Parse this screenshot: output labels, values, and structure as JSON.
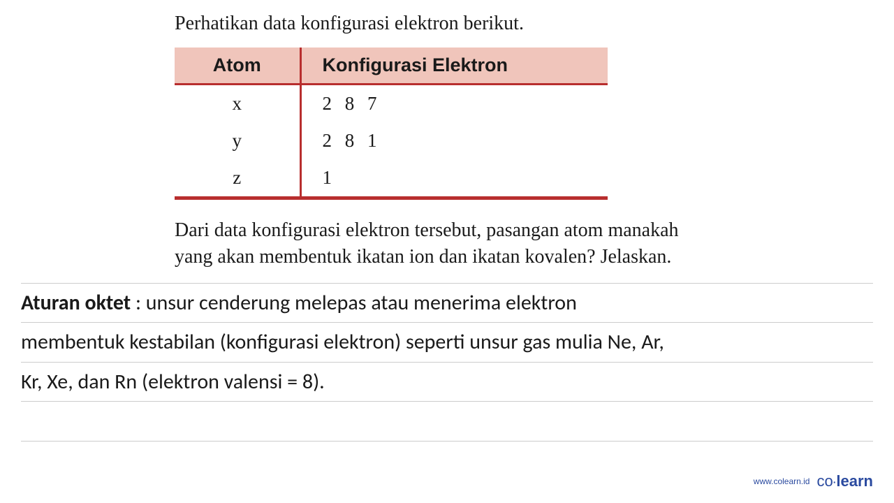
{
  "intro": "Perhatikan data konfigurasi elektron berikut.",
  "table": {
    "headers": {
      "col1": "Atom",
      "col2": "Konfigurasi Elektron"
    },
    "rows": [
      {
        "atom": "x",
        "config": "2 8 7"
      },
      {
        "atom": "y",
        "config": "2 8 1"
      },
      {
        "atom": "z",
        "config": "1"
      }
    ]
  },
  "question": "Dari data konfigurasi elektron tersebut, pasangan atom manakah yang akan membentuk ikatan ion dan ikatan kovalen? Jelaskan.",
  "explanation": {
    "term": "Aturan oktet",
    "line1_rest": " : unsur cenderung melepas atau menerima elektron",
    "line2": "membentuk kestabilan (konfigurasi elektron) seperti unsur gas mulia Ne, Ar,",
    "line3": " Kr, Xe, dan Rn (elektron valensi = 8)."
  },
  "footer": {
    "url": "www.colearn.id",
    "logo_prefix": "co",
    "logo_dot": "·",
    "logo_suffix": "learn"
  }
}
